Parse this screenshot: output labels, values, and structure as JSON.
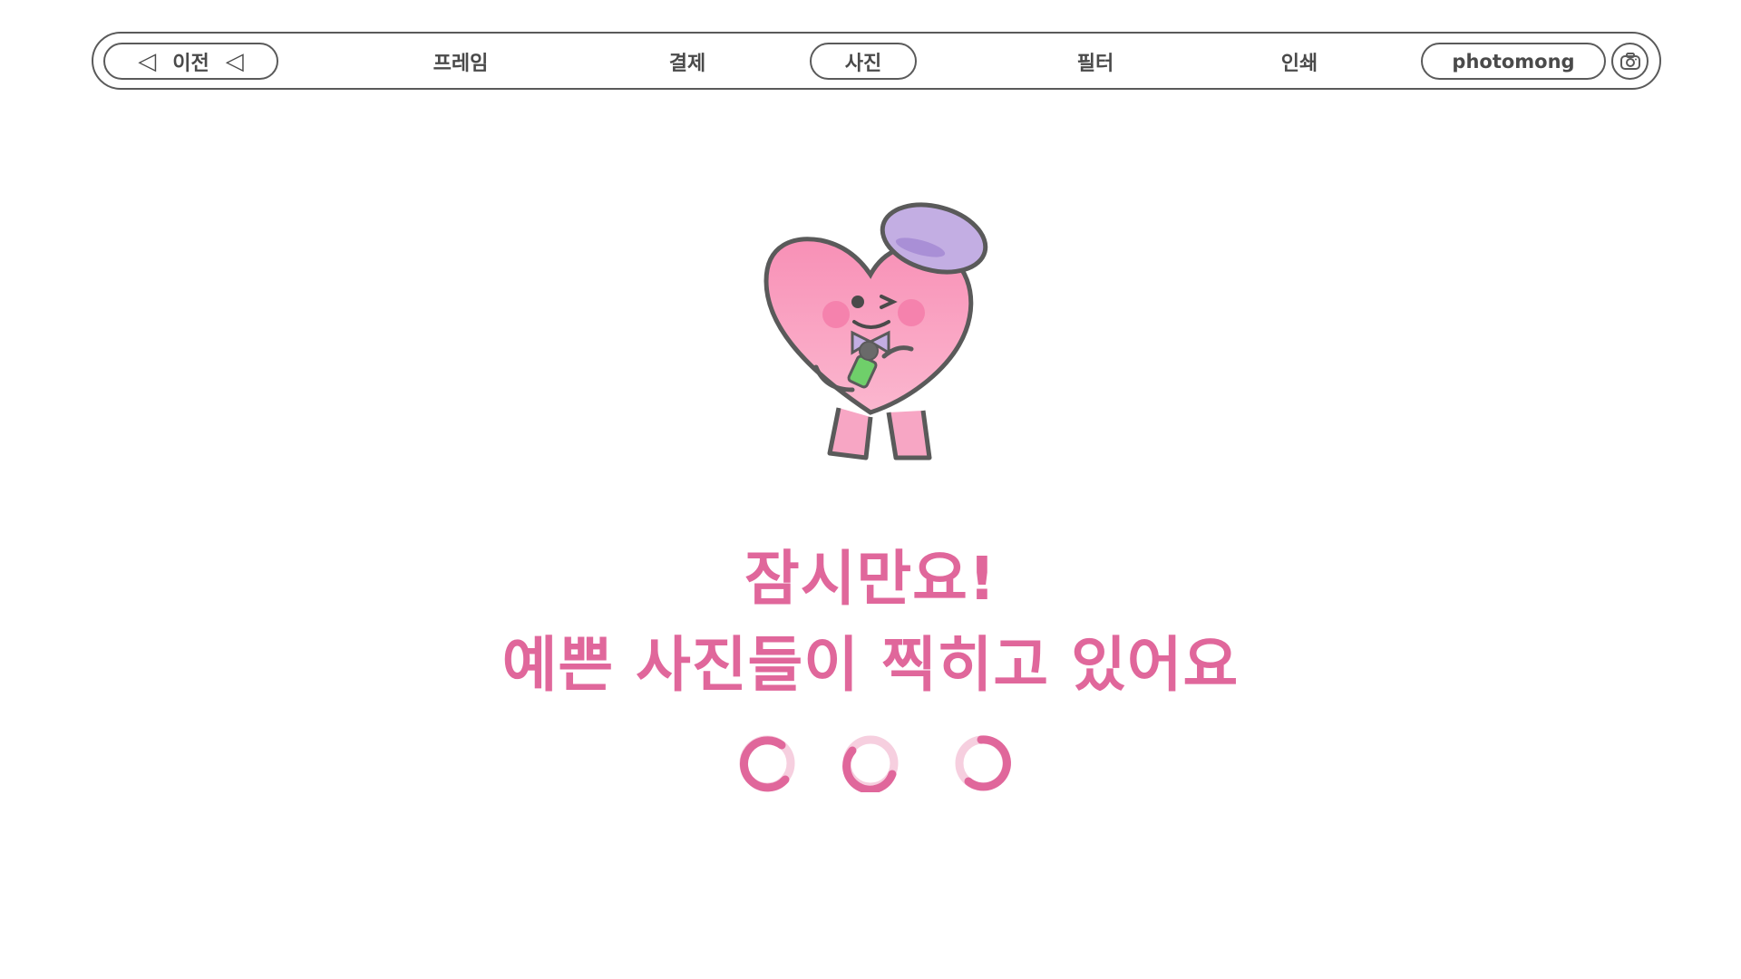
{
  "nav": {
    "prev_label": "이전",
    "steps": [
      "프레임",
      "결제",
      "사진",
      "필터",
      "인쇄"
    ],
    "active_step": "사진",
    "brand": "photomong"
  },
  "message": {
    "line1": "잠시만요!",
    "line2": "예쁜 사진들이 찍히고 있어요"
  },
  "colors": {
    "accent": "#e0679b",
    "outline": "#5a5a5a",
    "heart": "#f7a6c4",
    "hat": "#c3aee3"
  },
  "icons": {
    "prev": "triangle-left-icon",
    "camera": "camera-icon",
    "loading": "loading-spinner-icon"
  }
}
